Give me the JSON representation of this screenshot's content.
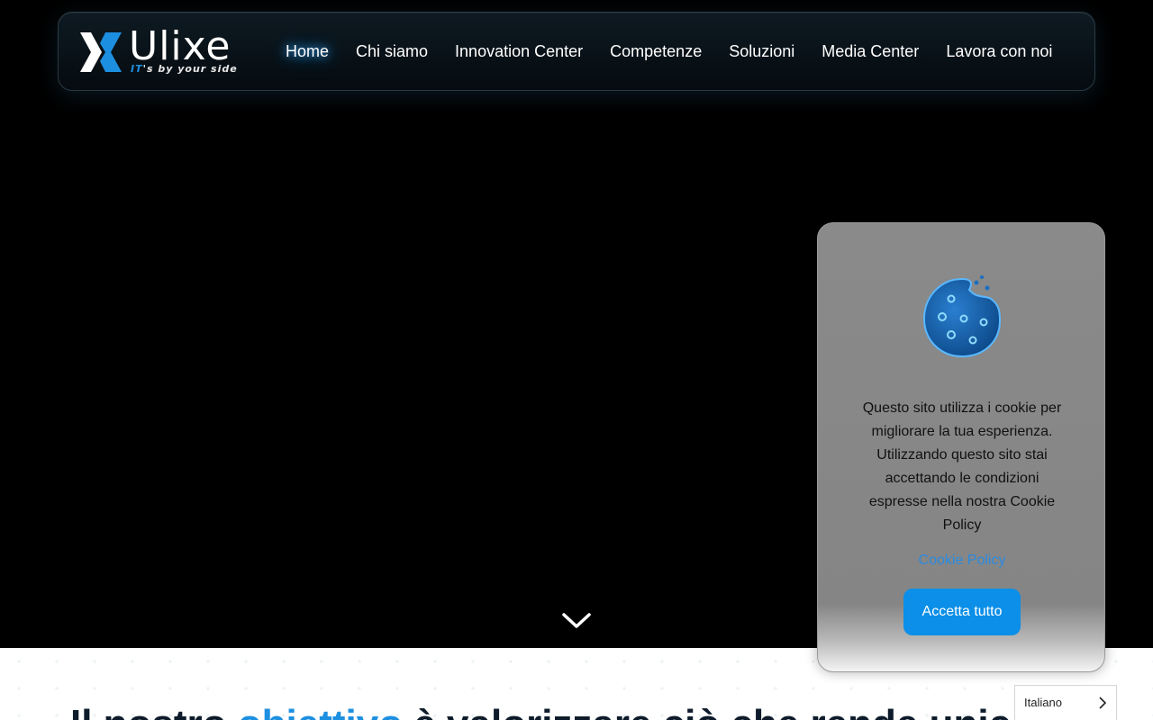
{
  "brand": {
    "name": "Ulixe",
    "tagline_it": "IT",
    "tagline_rest": "'s by your side",
    "accent": "#1d8fe0"
  },
  "nav": {
    "items": [
      {
        "label": "Home",
        "active": true
      },
      {
        "label": "Chi siamo"
      },
      {
        "label": "Innovation Center"
      },
      {
        "label": "Competenze"
      },
      {
        "label": "Soluzioni"
      },
      {
        "label": "Media Center"
      },
      {
        "label": "Lavora con noi"
      }
    ]
  },
  "hero": {
    "scroll_icon": "chevron-down-icon"
  },
  "content": {
    "headline_pre": "Il nostro ",
    "headline_highlight": "obiettivo",
    "headline_post": " è valorizzare ciò che rende unico il"
  },
  "cookie_banner": {
    "icon": "cookie-icon",
    "message": "Questo sito utilizza i cookie per migliorare la tua esperienza. Utilizzando questo sito stai accettando le condizioni espresse nella nostra Cookie Policy",
    "policy_link": "Cookie Policy",
    "accept_label": "Accetta tutto",
    "button_color": "#0b8fe8"
  },
  "language": {
    "current": "Italiano",
    "icon": "chevron-right-icon"
  }
}
